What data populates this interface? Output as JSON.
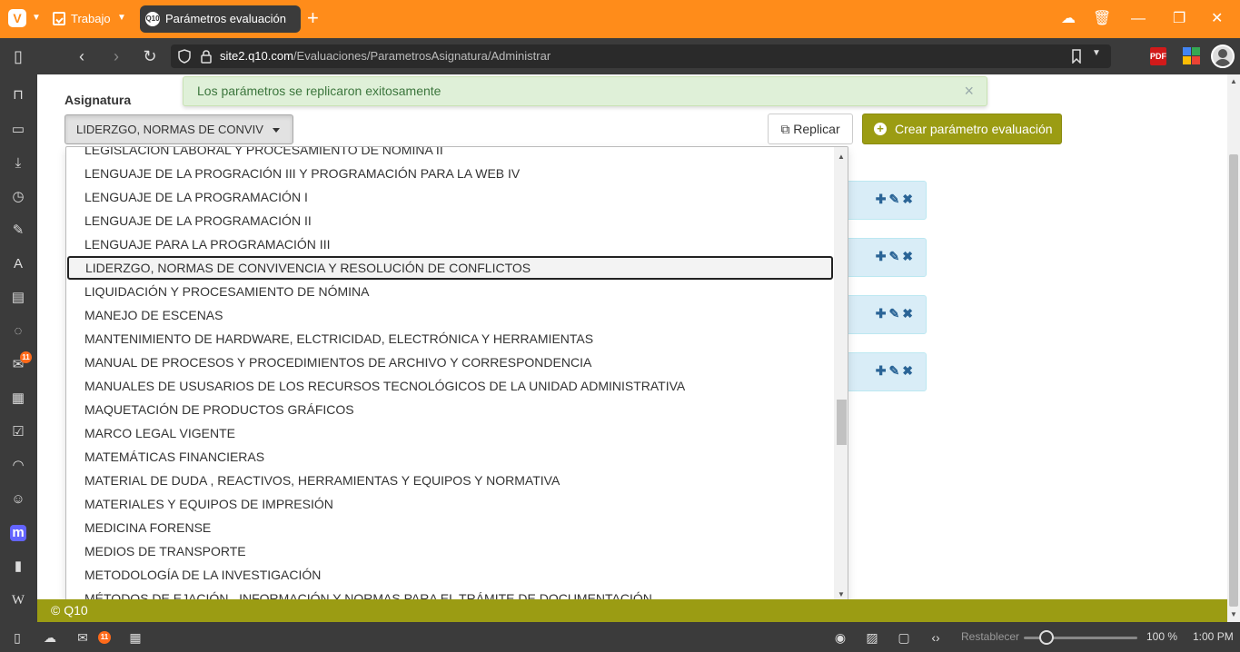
{
  "browser": {
    "workspace_label": "Trabajo",
    "tab_title": "Parámetros evaluación",
    "tab_favicon_text": "Q10",
    "new_tab": "+",
    "url_host": "site2.q10.com",
    "url_path": "/Evaluaciones/ParametrosAsignatura/Administrar",
    "pdf_ext_text": "PDF"
  },
  "sidepanel": {
    "icons": [
      "bookmarks-icon",
      "reading-list-icon",
      "downloads-icon",
      "history-icon",
      "notes-icon",
      "translate-icon",
      "calendar-panel-icon",
      "chat-icon",
      "mail-icon",
      "calendar-icon",
      "tasks-icon",
      "feeds-icon",
      "contacts-icon",
      "mastodon-icon",
      "document-icon",
      "wikipedia-icon"
    ],
    "mail_badge": "11",
    "wikipedia_label": "W",
    "mastodon_label": "m"
  },
  "page": {
    "alert_text": "Los parámetros se replicaron exitosamente",
    "alert_close": "×",
    "asignatura_label": "Asignatura",
    "asignatura_selected": "LIDERZGO, NORMAS DE CONVIV",
    "replicar_label": "Replicar",
    "crear_label": "Crear parámetro evaluación",
    "footer_text": "© Q10",
    "dropdown_items": [
      "LEGISLACIÓN LABORAL Y PROCESAMIENTO DE NÓMINA II",
      "LENGUAJE DE LA PROGRACIÓN III Y PROGRAMACIÓN PARA LA WEB IV",
      "LENGUAJE DE LA PROGRAMACIÓN I",
      "LENGUAJE DE LA PROGRAMACIÓN II",
      "LENGUAJE PARA LA PROGRAMACIÓN III",
      "LIDERZGO, NORMAS DE CONVIVENCIA Y RESOLUCIÓN DE CONFLICTOS",
      "LIQUIDACIÓN Y PROCESAMIENTO DE NÓMINA",
      "MANEJO DE ESCENAS",
      "MANTENIMIENTO DE HARDWARE, ELCTRICIDAD, ELECTRÓNICA Y HERRAMIENTAS",
      "MANUAL DE PROCESOS Y PROCEDIMIENTOS DE ARCHIVO Y CORRESPONDENCIA",
      "MANUALES DE USUSARIOS DE LOS RECURSOS TECNOLÓGICOS DE LA UNIDAD ADMINISTRATIVA",
      "MAQUETACIÓN DE PRODUCTOS GRÁFICOS",
      "MARCO LEGAL VIGENTE",
      "MATEMÁTICAS FINANCIERAS",
      "MATERIAL DE DUDA , REACTIVOS, HERRAMIENTAS Y EQUIPOS Y NORMATIVA",
      "MATERIALES Y EQUIPOS DE IMPRESIÓN",
      "MEDICINA FORENSE",
      "MEDIOS DE TRANSPORTE",
      "METODOLOGÍA DE LA INVESTIGACIÓN",
      "MÉTODOS DE EJACIÓN , INFORMACIÓN Y NORMAS PARA EL TRÁMITE DE DOCUMENTACIÓN"
    ],
    "selected_index": 5
  },
  "statusbar": {
    "mail_badge": "11",
    "reset_label": "Restablecer",
    "zoom_value": "100 %",
    "zoom_fraction": 0.2,
    "time": "1:00 PM"
  },
  "colors": {
    "brand_orange": "#ff8c1a",
    "q10_olive": "#9b9c13",
    "alert_green": "#dff0d8",
    "panel_blue": "#d9edf7"
  }
}
